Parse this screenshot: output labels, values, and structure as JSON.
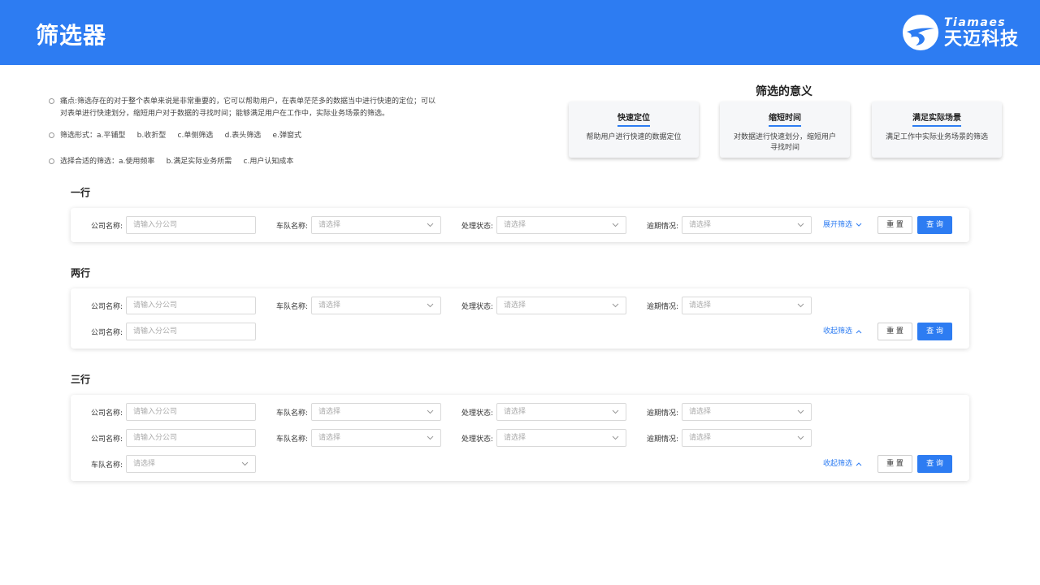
{
  "header": {
    "title": "筛选器",
    "brand_en": "Tiamaes",
    "brand_cn": "天迈科技",
    "accent": "#2d7cf2"
  },
  "points": [
    {
      "line1": "痛点:筛选存在的对于整个表单来说是非常重要的，它可以帮助用户，在表单茫茫多的数据当中进行快速的定位；可以",
      "line2": "对表单进行快速划分，缩短用户对于数据的寻找时间；能够满足用户在工作中，实际业务场景的筛选。"
    },
    {
      "line1": "筛选形式：a.平铺型     b.收折型     c.单侧筛选     d.表头筛选     e.弹窗式",
      "line2": ""
    },
    {
      "line1": "选择合适的筛选：a.使用频率     b.满足实际业务所需     c.用户认知成本",
      "line2": ""
    }
  ],
  "meaning": {
    "title": "筛选的意义",
    "cards": [
      {
        "title": "快速定位",
        "desc": "帮助用户进行快速的数据定位"
      },
      {
        "title": "缩短时间",
        "desc": "对数据进行快速划分，缩短用户寻找时间"
      },
      {
        "title": "满足实际场景",
        "desc": "满足工作中实际业务场景的筛选"
      }
    ]
  },
  "fields": {
    "company_label": "公司名称:",
    "company_placeholder": "请输入分公司",
    "team_label": "车队名称:",
    "status_label": "处理状态:",
    "overdue_label": "逾期情况:",
    "select_placeholder": "请选择"
  },
  "sections": {
    "one": {
      "label": "一行",
      "toggle": "展开筛选"
    },
    "two": {
      "label": "两行",
      "toggle": "收起筛选"
    },
    "three": {
      "label": "三行",
      "toggle": "收起筛选"
    }
  },
  "buttons": {
    "reset": "重 置",
    "query": "查 询"
  },
  "icons": {
    "chevron": "chevron-down-icon",
    "expand": "chevron-down-icon",
    "collapse": "chevron-up-icon",
    "logo": "tiamaes-logo-icon"
  }
}
